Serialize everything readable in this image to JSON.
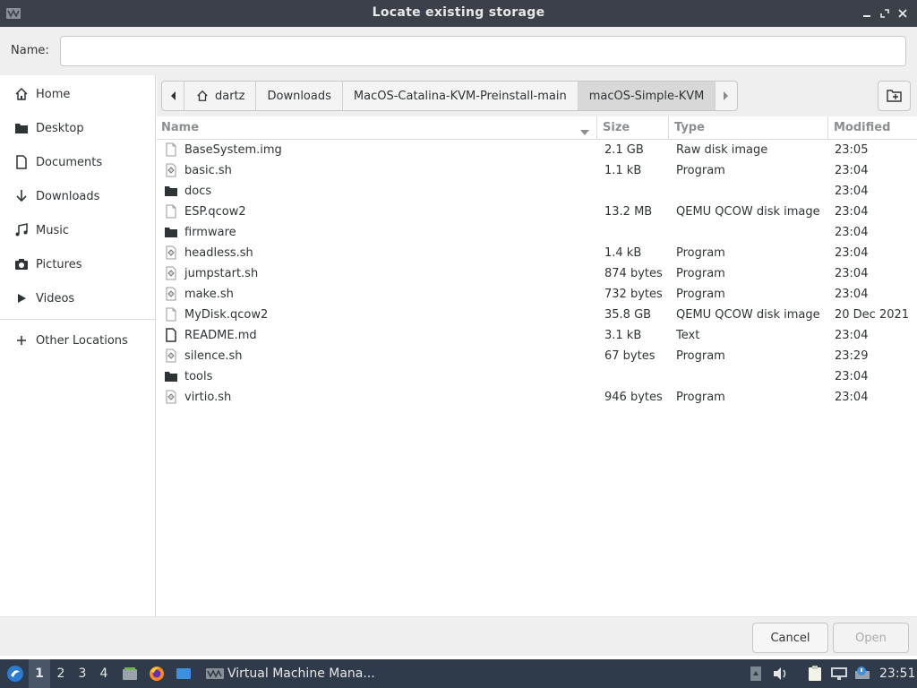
{
  "window": {
    "title": "Locate existing storage"
  },
  "name_field": {
    "label": "Name:",
    "value": ""
  },
  "sidebar": {
    "items": [
      {
        "label": "Home",
        "icon": "home-icon"
      },
      {
        "label": "Desktop",
        "icon": "folder-icon"
      },
      {
        "label": "Documents",
        "icon": "document-icon"
      },
      {
        "label": "Downloads",
        "icon": "download-icon"
      },
      {
        "label": "Music",
        "icon": "music-icon"
      },
      {
        "label": "Pictures",
        "icon": "camera-icon"
      },
      {
        "label": "Videos",
        "icon": "video-icon"
      }
    ],
    "other": {
      "label": "Other Locations",
      "icon": "plus-icon"
    }
  },
  "pathbar": {
    "segments": [
      "dartz",
      "Downloads",
      "MacOS-Catalina-KVM-Preinstall-main",
      "macOS-Simple-KVM"
    ],
    "active": "macOS-Simple-KVM"
  },
  "columns": {
    "name": "Name",
    "size": "Size",
    "type": "Type",
    "modified": "Modified"
  },
  "files": [
    {
      "name": "BaseSystem.img",
      "size": "2.1 GB",
      "type": "Raw disk image",
      "modified": "23:05",
      "icon": "file-icon"
    },
    {
      "name": "basic.sh",
      "size": "1.1 kB",
      "type": "Program",
      "modified": "23:04",
      "icon": "script-icon"
    },
    {
      "name": "docs",
      "size": "",
      "type": "",
      "modified": "23:04",
      "icon": "folder-icon"
    },
    {
      "name": "ESP.qcow2",
      "size": "13.2 MB",
      "type": "QEMU QCOW disk image",
      "modified": "23:04",
      "icon": "file-icon"
    },
    {
      "name": "firmware",
      "size": "",
      "type": "",
      "modified": "23:04",
      "icon": "folder-icon"
    },
    {
      "name": "headless.sh",
      "size": "1.4 kB",
      "type": "Program",
      "modified": "23:04",
      "icon": "script-icon"
    },
    {
      "name": "jumpstart.sh",
      "size": "874 bytes",
      "type": "Program",
      "modified": "23:04",
      "icon": "script-icon"
    },
    {
      "name": "make.sh",
      "size": "732 bytes",
      "type": "Program",
      "modified": "23:04",
      "icon": "script-icon"
    },
    {
      "name": "MyDisk.qcow2",
      "size": "35.8 GB",
      "type": "QEMU QCOW disk image",
      "modified": "20 Dec 2021",
      "icon": "file-icon"
    },
    {
      "name": "README.md",
      "size": "3.1 kB",
      "type": "Text",
      "modified": "23:04",
      "icon": "text-file-icon"
    },
    {
      "name": "silence.sh",
      "size": "67 bytes",
      "type": "Program",
      "modified": "23:29",
      "icon": "script-icon"
    },
    {
      "name": "tools",
      "size": "",
      "type": "",
      "modified": "23:04",
      "icon": "folder-icon"
    },
    {
      "name": "virtio.sh",
      "size": "946 bytes",
      "type": "Program",
      "modified": "23:04",
      "icon": "script-icon"
    }
  ],
  "buttons": {
    "cancel": "Cancel",
    "open": "Open"
  },
  "taskbar": {
    "workspaces": [
      "1",
      "2",
      "3",
      "4"
    ],
    "active_workspace": "1",
    "task": "Virtual Machine Mana...",
    "clock": "23:51"
  },
  "colors": {
    "titlebar": "#3c4149",
    "taskbar": "#2f3b4a",
    "active_path": "#d8d8d8"
  }
}
